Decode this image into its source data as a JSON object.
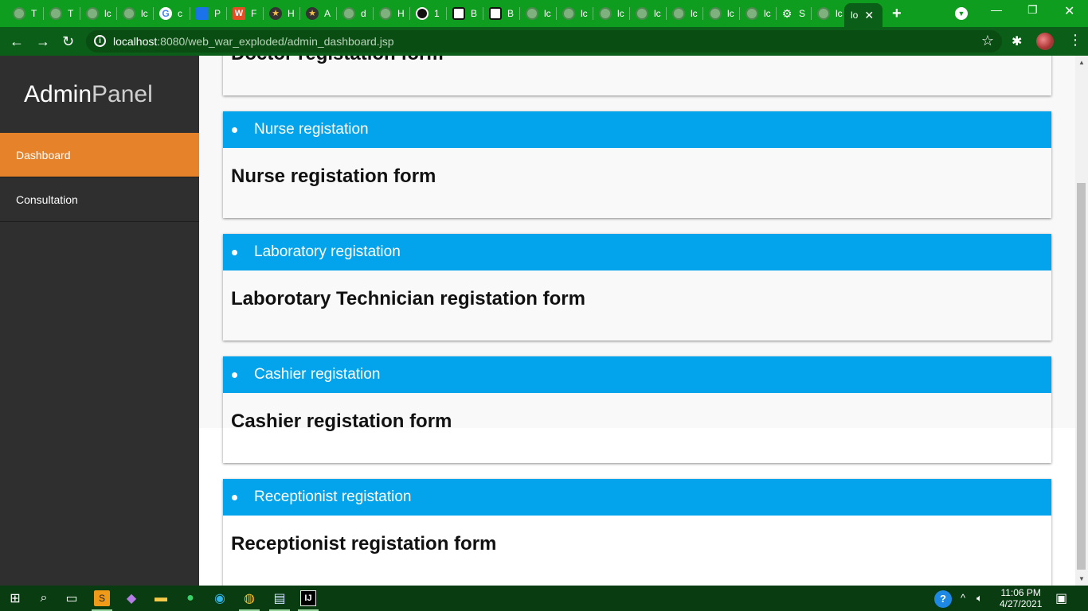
{
  "browser": {
    "tabs": [
      {
        "title": "T"
      },
      {
        "title": "T"
      },
      {
        "title": "lc"
      },
      {
        "title": "lc"
      },
      {
        "title": "c"
      },
      {
        "title": "P"
      },
      {
        "title": "F"
      },
      {
        "title": "H"
      },
      {
        "title": "A"
      },
      {
        "title": "d"
      },
      {
        "title": "H"
      },
      {
        "title": "1"
      },
      {
        "title": "B"
      },
      {
        "title": "B"
      },
      {
        "title": "lc"
      },
      {
        "title": "lc"
      },
      {
        "title": "lc"
      },
      {
        "title": "lc"
      },
      {
        "title": "lc"
      },
      {
        "title": "lc"
      },
      {
        "title": "lc"
      },
      {
        "title": "S"
      },
      {
        "title": "lc"
      }
    ],
    "active_tab": {
      "title": "lo"
    },
    "url_host": "localhost",
    "url_rest": ":8080/web_war_exploded/admin_dashboard.jsp"
  },
  "sidebar": {
    "brand_main": "Admin",
    "brand_sub": "Panel",
    "items": [
      {
        "label": "Dashboard"
      },
      {
        "label": "Consultation"
      }
    ]
  },
  "cards": [
    {
      "body": "Doctor registation form"
    },
    {
      "header": "Nurse registation",
      "body": "Nurse registation form"
    },
    {
      "header": "Laboratory registation",
      "body": "Laborotary Technician registation form"
    },
    {
      "header": "Cashier registation",
      "body": "Cashier registation form"
    },
    {
      "header": "Receptionist registation",
      "body": "Receptionist registation form"
    }
  ],
  "taskbar": {
    "time": "11:06 PM",
    "date": "4/27/2021"
  }
}
